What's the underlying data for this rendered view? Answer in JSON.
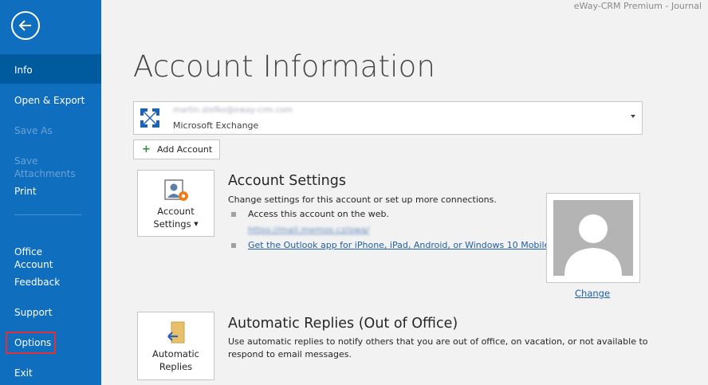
{
  "app": {
    "title": "eWay-CRM Premium - Journal"
  },
  "sidebar": {
    "items": [
      {
        "label": "Info"
      },
      {
        "label": "Open & Export"
      },
      {
        "label": "Save As"
      },
      {
        "label": "Save Attachments"
      },
      {
        "label": "Print"
      },
      {
        "label": "Office\nAccount"
      },
      {
        "label": "Feedback"
      },
      {
        "label": "Support"
      },
      {
        "label": "Options"
      },
      {
        "label": "Exit"
      }
    ]
  },
  "main": {
    "title": "Account Information",
    "account": {
      "email": "martin.stefko@eway-crm.com",
      "type": "Microsoft Exchange"
    },
    "add_account_label": "Add Account",
    "account_settings": {
      "tile_label_1": "Account",
      "tile_label_2": "Settings",
      "title": "Account Settings",
      "description": "Change settings for this account or set up more connections.",
      "bullet_1": "Access this account on the web.",
      "web_link": "https://mail.memos.cz/owa/",
      "bullet_2_link": "Get the Outlook app for iPhone, iPad, Android, or Windows 10 Mobile.",
      "change_label": "Change"
    },
    "auto_replies": {
      "tile_label_1": "Automatic",
      "tile_label_2": "Replies",
      "title": "Automatic Replies (Out of Office)",
      "description_1": "Use automatic replies to notify others that you are out of office, on vacation, or not available to",
      "description_2": "respond to email messages."
    }
  },
  "colors": {
    "sidebar": "#106ebe",
    "sidebar_active": "#005a9e",
    "link": "#1f5fa8",
    "highlight": "#e0303a"
  }
}
